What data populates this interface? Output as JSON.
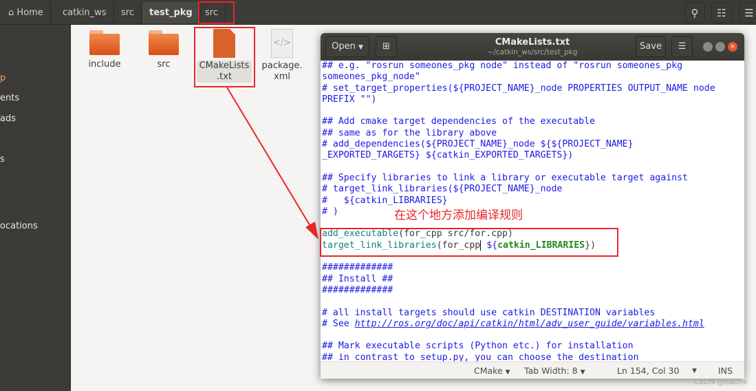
{
  "breadcrumb": [
    {
      "label": "Home",
      "icon": "home-icon"
    },
    {
      "label": "catkin_ws"
    },
    {
      "label": "src"
    },
    {
      "label": "test_pkg",
      "active": true
    },
    {
      "label": "src"
    }
  ],
  "header_buttons": [
    "search-icon",
    "view-list-icon",
    "menu-icon"
  ],
  "sidebar": {
    "items": [
      "p",
      "ents",
      "ads",
      "s",
      "ocations"
    ]
  },
  "files": [
    {
      "name": "include",
      "type": "folder"
    },
    {
      "name": "src",
      "type": "folder"
    },
    {
      "name": "CMakeLists\n.txt",
      "type": "text",
      "selected": true
    },
    {
      "name": "package.\nxml",
      "type": "xml"
    }
  ],
  "file_labels": {
    "f0": "include",
    "f1": "src",
    "f2a": "CMakeLists",
    "f2b": ".txt",
    "f3a": "package.",
    "f3b": "xml"
  },
  "editor": {
    "open_label": "Open",
    "save_label": "Save",
    "title": "CMakeLists.txt",
    "path": "~/catkin_ws/src/test_pkg",
    "lines": [
      "## e.g. \"rosrun someones_pkg node\" instead of \"rosrun someones_pkg",
      "someones_pkg_node\"",
      "# set_target_properties(${PROJECT_NAME}_node PROPERTIES OUTPUT_NAME node",
      "PREFIX \"\")",
      "",
      "## Add cmake target dependencies of the executable",
      "## same as for the library above",
      "# add_dependencies(${PROJECT_NAME}_node ${${PROJECT_NAME}",
      "_EXPORTED_TARGETS} ${catkin_EXPORTED_TARGETS})",
      "",
      "## Specify libraries to link a library or executable target against",
      "# target_link_libraries(${PROJECT_NAME}_node",
      "#   ${catkin_LIBRARIES}",
      "# )",
      ""
    ],
    "code_add": {
      "fn": "add_executable",
      "args": "(for_cpp src/for.cpp)"
    },
    "code_link": {
      "fn": "target_link_libraries",
      "args": "(for_cpp",
      "sp": " ${",
      "kw": "catkin_LIBRARIES",
      "end": "})"
    },
    "lines2": [
      "",
      "#############",
      "## Install ##",
      "#############",
      "",
      "# all install targets should use catkin DESTINATION variables"
    ],
    "see_prefix": "# See ",
    "see_url": "http://ros.org/doc/api/catkin/html/adv_user_guide/variables.html",
    "lines3": [
      "",
      "## Mark executable scripts (Python etc.) for installation",
      "## in contrast to setup.py, you can choose the destination"
    ],
    "status": {
      "language": "CMake",
      "tab_width": "Tab Width: 8",
      "position": "Ln 154, Col 30",
      "mode": "INS"
    }
  },
  "annotation": "在这个地方添加编译规则",
  "watermark": "CSDN @cacrle",
  "colors": {
    "annotation": "#e8262a",
    "comment": "#1a1ae6",
    "function": "#11807f"
  }
}
